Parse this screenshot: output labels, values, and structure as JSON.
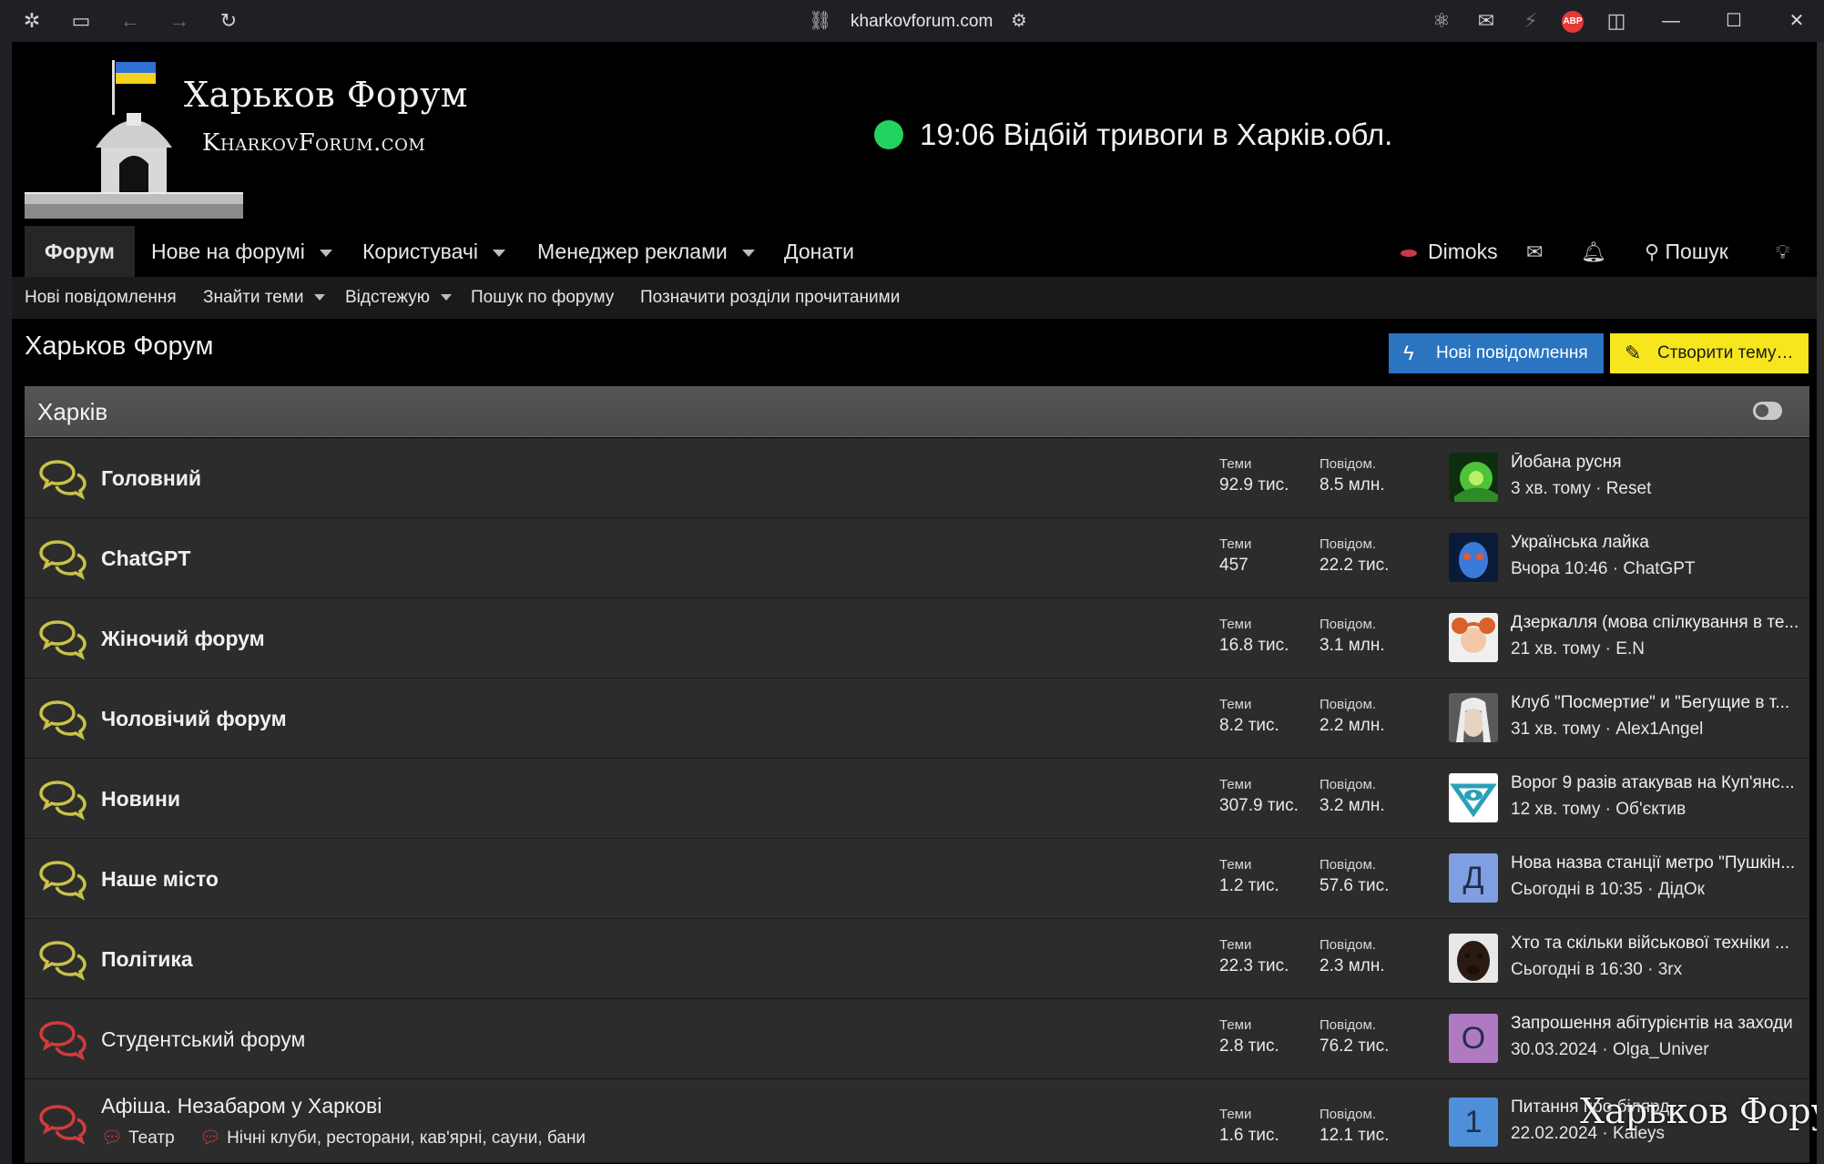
{
  "browser": {
    "url": "kharkovforum.com",
    "adblock_label": "ABP"
  },
  "header": {
    "logo_title": "Харьков Форум",
    "logo_subtitle": "KharkovForum.com",
    "alert_text": "19:06 Відбій тривоги в Харків.обл.",
    "alert_color": "#22d45f"
  },
  "nav": {
    "items": [
      {
        "label": "Форум",
        "active": true
      },
      {
        "label": "Нове на форумі",
        "dropdown": true
      },
      {
        "label": "Користувачі",
        "dropdown": true
      },
      {
        "label": "Менеджер реклами",
        "dropdown": true
      },
      {
        "label": "Донати"
      }
    ],
    "user": "Dimoks",
    "search_label": "Пошук"
  },
  "subnav": {
    "items": [
      {
        "label": "Нові повідомлення"
      },
      {
        "label": "Знайти теми",
        "dropdown": true
      },
      {
        "label": "Відстежую",
        "dropdown": true
      },
      {
        "label": "Пошук по форуму"
      },
      {
        "label": "Позначити розділи прочитаними"
      }
    ]
  },
  "page": {
    "title": "Харьков Форум",
    "new_posts_button": "Нові повідомлення",
    "create_thread_button": "Створити тему…",
    "accent_blue": "#2a74c0",
    "accent_yellow": "#f7e51d"
  },
  "category": {
    "title": "Харків",
    "forums": [
      {
        "name": "Головний",
        "unread": true,
        "topics_label": "Теми",
        "topics": "92.9 тис.",
        "posts_label": "Повідом.",
        "posts": "8.5 млн.",
        "last_title": "Йобана русня",
        "last_meta": "3 хв. тому · Reset",
        "avatar": "chameleon"
      },
      {
        "name": "ChatGPT",
        "unread": true,
        "topics_label": "Теми",
        "topics": "457",
        "posts_label": "Повідом.",
        "posts": "22.2 тис.",
        "last_title": "Українська лайка",
        "last_meta": "Вчора 10:46 · ChatGPT",
        "avatar": "robot"
      },
      {
        "name": "Жіночий форум",
        "unread": true,
        "topics_label": "Теми",
        "topics": "16.8 тис.",
        "posts_label": "Повідом.",
        "posts": "3.1 млн.",
        "last_title": "Дзеркалля (мова спілкування в те...",
        "last_meta": "21 хв. тому · E.N",
        "avatar": "redhead"
      },
      {
        "name": "Чоловічий форум",
        "unread": true,
        "topics_label": "Теми",
        "topics": "8.2 тис.",
        "posts_label": "Повідом.",
        "posts": "2.2 млн.",
        "last_title": "Клуб \"Посмертие\" и \"Бегущие в т...",
        "last_meta": "31 хв. тому · Alex1Angel",
        "avatar": "warrior"
      },
      {
        "name": "Новини",
        "unread": true,
        "topics_label": "Теми",
        "topics": "307.9 тис.",
        "posts_label": "Повідом.",
        "posts": "3.2 млн.",
        "last_title": "Ворог 9 разів атакував на Куп'янс...",
        "last_meta": "12 хв. тому · Об'єктив",
        "avatar": "eye-logo"
      },
      {
        "name": "Наше місто",
        "unread": true,
        "topics_label": "Теми",
        "topics": "1.2 тис.",
        "posts_label": "Повідом.",
        "posts": "57.6 тис.",
        "last_title": "Нова назва станції метро \"Пушкін...",
        "last_meta": "Сьогодні в 10:35 · ДідОк",
        "avatar_letter": "Д",
        "avatar_bg": "#7f9fe0"
      },
      {
        "name": "Політика",
        "unread": true,
        "topics_label": "Теми",
        "topics": "22.3 тис.",
        "posts_label": "Повідом.",
        "posts": "2.3 млн.",
        "last_title": "Хто та скільки військової техніки ...",
        "last_meta": "Сьогодні в 16:30 · 3rx",
        "avatar": "dog"
      },
      {
        "name": "Студентський форум",
        "unread": false,
        "topics_label": "Теми",
        "topics": "2.8 тис.",
        "posts_label": "Повідом.",
        "posts": "76.2 тис.",
        "last_title": "Запрошення абітурієнтів на заходи",
        "last_meta": "30.03.2024 · Olga_Univer",
        "avatar_letter": "О",
        "avatar_bg": "#b07ac2"
      },
      {
        "name": "Афіша. Незабаром у Харкові",
        "unread": false,
        "topics_label": "Теми",
        "topics": "1.6 тис.",
        "posts_label": "Повідом.",
        "posts": "12.1 тис.",
        "last_title": "Питання про білярд",
        "last_meta": "22.02.2024 · Kaleys",
        "avatar_letter": "1",
        "avatar_bg": "#4f8ed8",
        "subforums": [
          "Театр",
          "Нічні клуби, ресторани, кав'ярні, сауни, бани"
        ]
      }
    ]
  },
  "watermark": "Харьков Форум",
  "colors": {
    "forum_icon_unread": "#c9c14a",
    "forum_icon_read": "#d33b3b",
    "row_bg": "#2c2c2c"
  }
}
